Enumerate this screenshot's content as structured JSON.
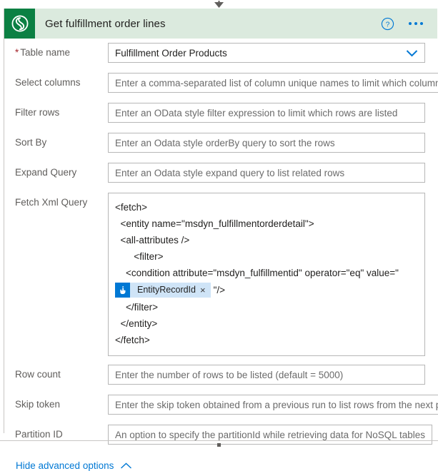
{
  "card": {
    "title": "Get fulfillment order lines",
    "connector_icon": "dataverse-logo-icon",
    "help_icon": "help-circle-icon",
    "more_icon": "ellipsis-icon",
    "accent_green": "#0b8043",
    "header_bg": "#dbeade",
    "accent_blue": "#0078d4",
    "required_star_color": "#a4262c"
  },
  "fields": [
    {
      "label": "Table name",
      "required": true,
      "required_marker": "*",
      "type": "combobox",
      "value": "Fulfillment Order Products",
      "placeholder": "",
      "chevron_icon": "chevron-down-icon"
    },
    {
      "label": "Select columns",
      "required": false,
      "required_marker": "",
      "type": "text",
      "value": "",
      "placeholder": "Enter a comma-separated list of column unique names to limit which columns are returned"
    },
    {
      "label": "Filter rows",
      "required": false,
      "required_marker": "",
      "type": "text",
      "value": "",
      "placeholder": "Enter an OData style filter expression to limit which rows are listed"
    },
    {
      "label": "Sort By",
      "required": false,
      "required_marker": "",
      "type": "text",
      "value": "",
      "placeholder": "Enter an Odata style orderBy query to sort the rows"
    },
    {
      "label": "Expand Query",
      "required": false,
      "required_marker": "",
      "type": "text",
      "value": "",
      "placeholder": "Enter an Odata style expand query to list related rows"
    }
  ],
  "fetch_xml": {
    "label": "Fetch Xml Query",
    "lines_before_token": [
      "<fetch>",
      "  <entity name=\"msdyn_fulfillmentorderdetail\">",
      "  <all-attributes />",
      "       <filter>",
      "    <condition attribute=\"msdyn_fulfillmentid\" operator=\"eq\" value=\""
    ],
    "token": {
      "label": "EntityRecordId",
      "icon": "manual-trigger-hand-icon",
      "close_label": "×",
      "chip_bg": "#cfe4f7",
      "icon_bg": "#0078d4"
    },
    "text_after_token": "\"/>",
    "lines_after_token": [
      "    </filter>",
      "  </entity>",
      "</fetch>"
    ]
  },
  "fields_bottom": [
    {
      "label": "Row count",
      "required": false,
      "required_marker": "",
      "type": "text",
      "value": "",
      "placeholder": "Enter the number of rows to be listed (default = 5000)"
    },
    {
      "label": "Skip token",
      "required": false,
      "required_marker": "",
      "type": "text",
      "value": "",
      "placeholder": "Enter the skip token obtained from a previous run to list rows from the next page"
    },
    {
      "label": "Partition ID",
      "required": false,
      "required_marker": "",
      "type": "text",
      "value": "",
      "placeholder": "An option to specify the partitionId while retrieving data for NoSQL tables"
    }
  ],
  "footer": {
    "advanced_options_label": "Hide advanced options",
    "advanced_options_icon": "chevron-up-icon"
  }
}
